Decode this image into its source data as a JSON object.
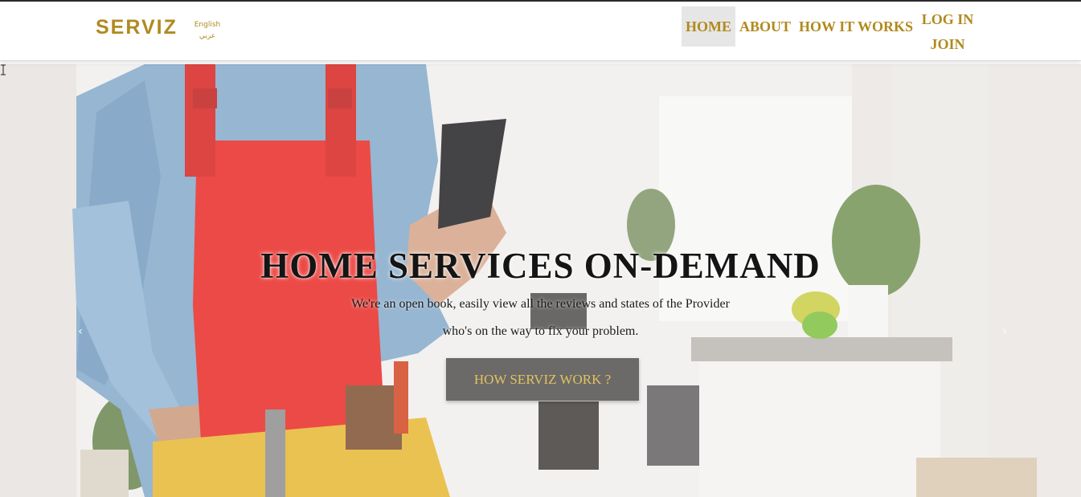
{
  "brand": {
    "name": "SERVIZ"
  },
  "language": {
    "english": "English",
    "arabic": "عربي"
  },
  "nav": {
    "items": [
      {
        "label": "HOME",
        "active": true
      },
      {
        "label": "ABOUT"
      },
      {
        "label": "HOW IT WORKS"
      }
    ],
    "login": "LOG IN",
    "join": "JOIN"
  },
  "hero": {
    "title": "HOME SERVICES ON-DEMAND",
    "subtitle_line1": "We're an open book, easily view all the reviews and states of the Provider",
    "subtitle_line2": "who's on the way to fix your problem.",
    "cta_label": "HOW SERVIZ WORK ?",
    "prev_arrow": "‹",
    "next_arrow": "›"
  },
  "colors": {
    "accent_gold": "#b08a1e",
    "button_bg": "#6b6a69",
    "button_text": "#e3c25d",
    "apron_red": "#e8231e",
    "shirt_denim": "#7fa7c9"
  },
  "icons": [
    "chevron-left-icon",
    "chevron-right-icon",
    "text-cursor-icon"
  ]
}
